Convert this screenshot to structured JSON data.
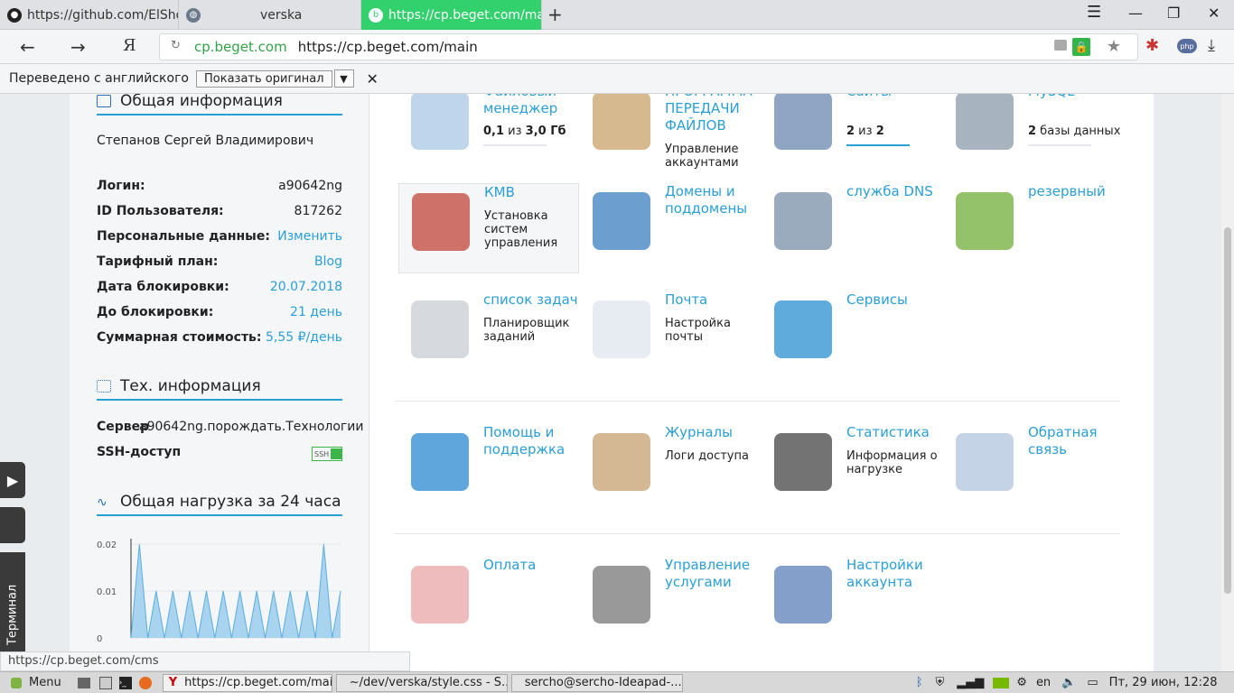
{
  "tabs": [
    {
      "title": "https://github.com/ElShoN",
      "icon": "github-icon"
    },
    {
      "title": "verska",
      "icon": "globe-icon"
    },
    {
      "title": "https://cp.beget.com/ma",
      "icon": "beget-icon",
      "active": true
    }
  ],
  "nav": {
    "domain": "cp.beget.com",
    "url": "https://cp.beget.com/main"
  },
  "translate": {
    "text": "Переведено с английского",
    "show_original": "Показать оригинал"
  },
  "left": {
    "general_title": "Общая информация",
    "user_name": "Степанов Сергей Владимирович",
    "rows": [
      {
        "key": "Логин:",
        "value": "a90642ng",
        "link": false
      },
      {
        "key": "ID Пользователя:",
        "value": "817262",
        "link": false
      },
      {
        "key": "Персональные данные:",
        "value": "Изменить",
        "link": true
      },
      {
        "key": "Тарифный план:",
        "value": "Blog",
        "link": true
      },
      {
        "key": "Дата блокировки:",
        "value": "20.07.2018",
        "link": true
      },
      {
        "key": "До блокировки:",
        "value": "21 день",
        "link": true
      },
      {
        "key": "Суммарная стоимость:",
        "value": "5,55 ₽/день",
        "link": true
      }
    ],
    "tech_title": "Тех. информация",
    "server_key": "Сервер",
    "server_value": "a90642ng.порождать.Технологии",
    "ssh_key": "SSH-доступ",
    "ssh_badge": "SSH",
    "load_title": "Общая нагрузка за 24 часа"
  },
  "chart_data": {
    "type": "area",
    "yticks": [
      "0.02",
      "0.01",
      "0"
    ],
    "ylim": [
      0,
      0.02
    ],
    "values": [
      0,
      0.02,
      0,
      0.01,
      0,
      0.01,
      0,
      0.01,
      0,
      0.01,
      0,
      0.01,
      0,
      0.01,
      0,
      0.01,
      0,
      0.01,
      0,
      0.01,
      0,
      0.01,
      0,
      0.02,
      0,
      0.01
    ]
  },
  "tiles": [
    {
      "name": "file-manager",
      "title": "Файловый менеджер",
      "desc_bold_a": "0,1",
      "desc_mid": " из ",
      "desc_bold_b": "3,0 Гб",
      "top": -12
    },
    {
      "name": "ftp",
      "title": "ПРОГРАММА ПЕРЕДАЧИ ФАЙЛОВ",
      "desc": "Управление аккаунтами",
      "top": -12
    },
    {
      "name": "sites",
      "title": "Сайты",
      "desc_bold_a": "2",
      "desc_mid": " из ",
      "desc_bold_b": "2",
      "top": -12
    },
    {
      "name": "mysql",
      "title": "MySQL",
      "desc_bold_a": "2",
      "desc_mid": " базы данных",
      "top": -12
    },
    {
      "name": "cms",
      "title": "КМВ",
      "desc": "Установка систем управления"
    },
    {
      "name": "domains",
      "title": "Домены и поддомены"
    },
    {
      "name": "dns",
      "title": "служба DNS"
    },
    {
      "name": "backup",
      "title": "резервный"
    },
    {
      "name": "cron",
      "title": "список задач",
      "desc": "Планировщик заданий"
    },
    {
      "name": "mail",
      "title": "Почта",
      "desc": "Настройка почты"
    },
    {
      "name": "services",
      "title": "Сервисы"
    },
    {
      "name": "support",
      "title": "Помощь и поддержка"
    },
    {
      "name": "logs",
      "title": "Журналы",
      "desc": "Логи доступа"
    },
    {
      "name": "stats",
      "title": "Статистика",
      "desc": "Информация о нагрузке"
    },
    {
      "name": "feedback",
      "title": "Обратная связь"
    },
    {
      "name": "payment",
      "title": "Оплата"
    },
    {
      "name": "services-mgmt",
      "title": "Управление услугами"
    },
    {
      "name": "account-settings",
      "title": "Настройки аккаунта"
    }
  ],
  "dock": {
    "terminal": "Терминал"
  },
  "status_url": "https://cp.beget.com/cms",
  "taskbar": {
    "menu": "Menu",
    "windows": [
      "https://cp.beget.com/mai...",
      "~/dev/verska/style.css - S...",
      "sercho@sercho-Ideapad-..."
    ],
    "lang": "en",
    "clock": "Пт, 29 июн, 12:28"
  },
  "colors": {
    "accent": "#2a9fd6",
    "active_tab": "#33d16d"
  }
}
